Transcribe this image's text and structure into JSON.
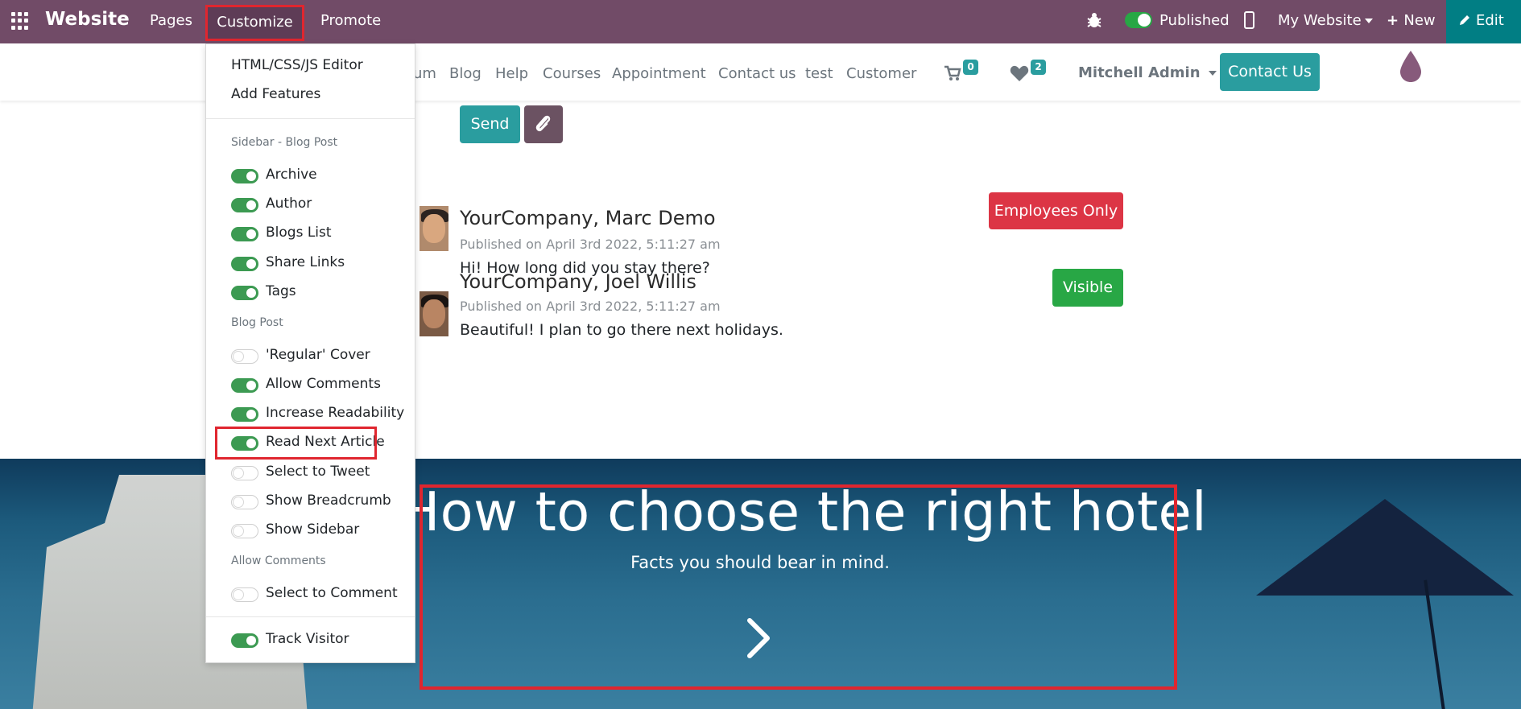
{
  "topbar": {
    "brand": "Website",
    "menu": [
      "Pages",
      "Customize",
      "Promote"
    ],
    "published_label": "Published",
    "site_selector": "My Website",
    "new_label": "New",
    "edit_label": "Edit",
    "colors": {
      "bar": "#714b67",
      "edit": "#017e84",
      "toggle_on": "#28a745"
    }
  },
  "site_nav": {
    "links": [
      "um",
      "Blog",
      "Help",
      "Courses",
      "Appointment",
      "Contact us",
      "test",
      "Customer"
    ],
    "cart_count": "0",
    "wishlist_count": "2",
    "user": "Mitchell Admin",
    "cta": "Contact Us",
    "accent": "#2a9d9f"
  },
  "composer": {
    "send_label": "Send"
  },
  "comments": [
    {
      "author": "YourCompany, Marc Demo",
      "date": "Published on April 3rd 2022, 5:11:27 am",
      "body": "Hi! How long did you stay there?",
      "tag": "Employees Only"
    },
    {
      "author": "YourCompany, Joel Willis",
      "date": "Published on April 3rd 2022, 5:11:27 am",
      "body": "Beautiful! I plan to go there next holidays.",
      "tag": "Visible"
    }
  ],
  "hero": {
    "title": "How to choose the right hotel",
    "subtitle": "Facts you should bear in mind."
  },
  "dropdown": {
    "links": [
      "HTML/CSS/JS Editor",
      "Add Features"
    ],
    "groups": [
      {
        "header": "Sidebar - Blog Post",
        "options": [
          {
            "label": "Archive",
            "on": true
          },
          {
            "label": "Author",
            "on": true
          },
          {
            "label": "Blogs List",
            "on": true
          },
          {
            "label": "Share Links",
            "on": true
          },
          {
            "label": "Tags",
            "on": true
          }
        ]
      },
      {
        "header": "Blog Post",
        "options": [
          {
            "label": "'Regular' Cover",
            "on": false
          },
          {
            "label": "Allow Comments",
            "on": true
          },
          {
            "label": "Increase Readability",
            "on": true
          },
          {
            "label": "Read Next Article",
            "on": true
          },
          {
            "label": "Select to Tweet",
            "on": false
          },
          {
            "label": "Show Breadcrumb",
            "on": false
          },
          {
            "label": "Show Sidebar",
            "on": false
          }
        ]
      },
      {
        "header": "Allow Comments",
        "options": [
          {
            "label": "Select to Comment",
            "on": false
          }
        ]
      }
    ],
    "footer_option": {
      "label": "Track Visitor",
      "on": true
    }
  }
}
